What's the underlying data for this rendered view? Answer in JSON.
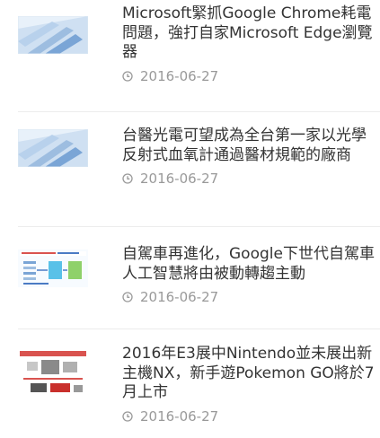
{
  "articles": [
    {
      "title": "Microsoft緊抓Google Chrome耗電問題，強打自家Microsoft Edge瀏覽器",
      "date": "2016-06-27",
      "thumbnail": "generic-article-thumbnail"
    },
    {
      "title": "台醫光電可望成為全台第一家以光學反射式血氧計通過醫材規範的廠商",
      "date": "2016-06-27",
      "thumbnail": "generic-article-thumbnail"
    },
    {
      "title": "自駕車再進化，Google下世代自駕車人工智慧將由被動轉趨主動",
      "date": "2016-06-27",
      "thumbnail": "slide-diagram-thumbnail"
    },
    {
      "title": "2016年E3展中Nintendo並未展出新主機NX，新手遊Pokemon GO將於7月上市",
      "date": "2016-06-27",
      "thumbnail": "slide-presentation-thumbnail"
    }
  ],
  "icons": {
    "date": "clock-icon"
  },
  "colors": {
    "title": "#333333",
    "date": "#999999",
    "divider": "#ececec",
    "link_hover": "#1a73c8"
  }
}
